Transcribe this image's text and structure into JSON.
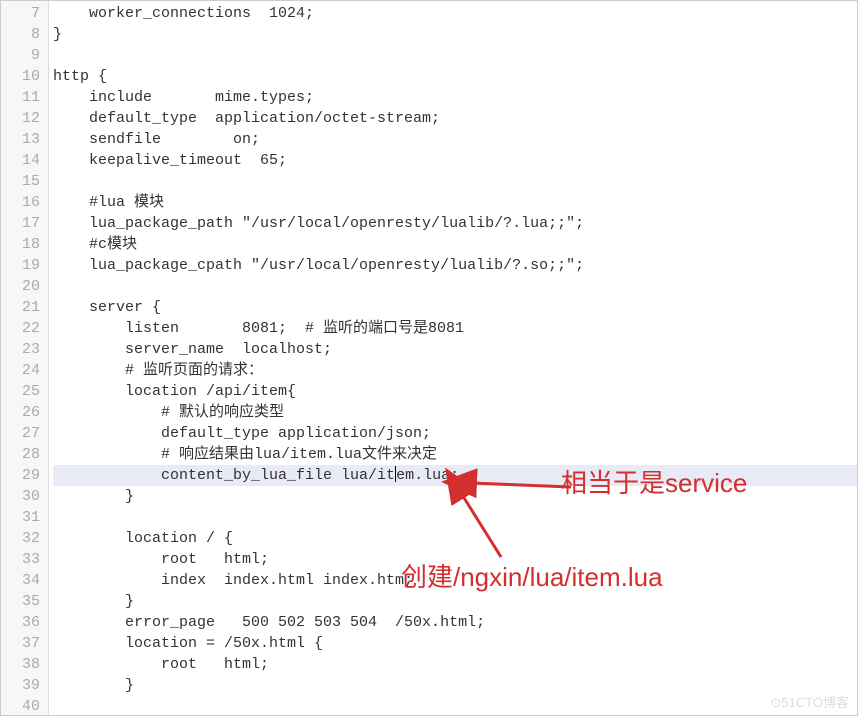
{
  "gutter": {
    "start": 7,
    "end": 40
  },
  "lines": [
    "    worker_connections  1024;",
    "}",
    "",
    "http {",
    "    include       mime.types;",
    "    default_type  application/octet-stream;",
    "    sendfile        on;",
    "    keepalive_timeout  65;",
    "",
    "    #lua 模块",
    "    lua_package_path \"/usr/local/openresty/lualib/?.lua;;\";",
    "    #c模块",
    "    lua_package_cpath \"/usr/local/openresty/lualib/?.so;;\";",
    "",
    "    server {",
    "        listen       8081;  # 监听的端口号是8081",
    "        server_name  localhost;",
    "        # 监听页面的请求：",
    "        location /api/item{",
    "            # 默认的响应类型",
    "            default_type application/json;",
    "            # 响应结果由lua/item.lua文件来决定",
    "            content_by_lua_file lua/item.lua;",
    "        }",
    "",
    "        location / {",
    "            root   html;",
    "            index  index.html index.htm;",
    "        }",
    "        error_page   500 502 503 504  /50x.html;",
    "        location = /50x.html {",
    "            root   html;",
    "        }",
    ""
  ],
  "highlighted_index": 22,
  "annotations": {
    "a1": "相当于是service",
    "a2": "创建/ngxin/lua/item.lua"
  },
  "watermark": "⊙51CTO博客"
}
